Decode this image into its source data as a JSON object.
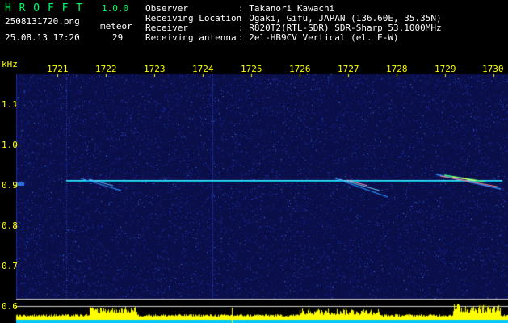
{
  "header": {
    "app_name": "H R O F F T",
    "app_version": "1.0.0",
    "filename": "2508131720.png",
    "datetime": "25.08.13 17:20",
    "meteor_label": "meteor",
    "meteor_count": "29",
    "info": [
      {
        "label": "Observer",
        "value": ": Takanori Kawachi"
      },
      {
        "label": "Receiving Location",
        "value": ": Ogaki, Gifu, JAPAN (136.60E, 35.35N)"
      },
      {
        "label": "Receiver",
        "value": ": R820T2(RTL-SDR) SDR-Sharp 53.1000MHz"
      },
      {
        "label": "Receiving antenna",
        "value": ": 2el-HB9CV Vertical (el. E-W)"
      }
    ]
  },
  "axes": {
    "y_unit": "kHz",
    "x_ticks": [
      "1721",
      "1722",
      "1723",
      "1724",
      "1725",
      "1726",
      "1727",
      "1728",
      "1729",
      "1730"
    ],
    "y_ticks": [
      "1.1",
      "1.0",
      "0.9",
      "0.8",
      "0.7",
      "0.6"
    ]
  },
  "colors": {
    "background": "#000000",
    "label_yellow": "#ffff00",
    "title_green": "#00ff66",
    "noise_blue": "#1a2a9a",
    "signal_cyan": "#00e0ff",
    "bar_cyan": "#00c8ff"
  }
}
